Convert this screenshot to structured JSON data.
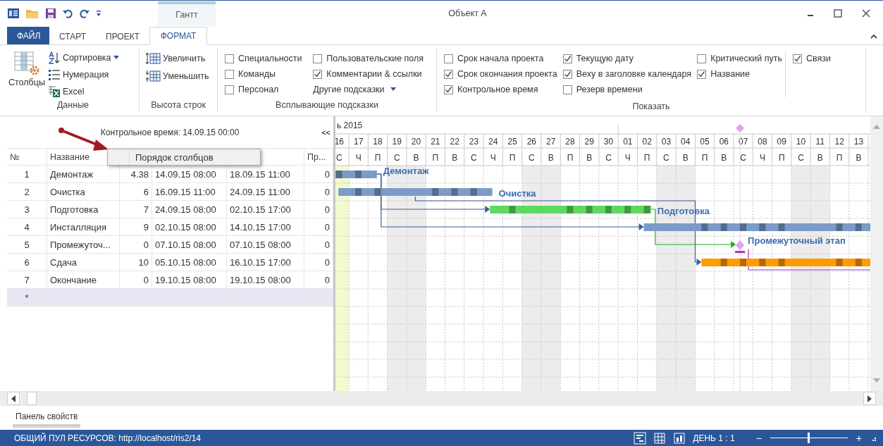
{
  "window": {
    "title": "Объект А",
    "context_tab": "Гантт"
  },
  "ribbon_tabs": [
    {
      "label": "ФАЙЛ",
      "kind": "file",
      "selected": false
    },
    {
      "label": "СТАРТ",
      "kind": "tab",
      "selected": false
    },
    {
      "label": "ПРОЕКТ",
      "kind": "tab",
      "selected": false
    },
    {
      "label": "ФОРМАТ",
      "kind": "tab",
      "selected": true
    }
  ],
  "data_group": {
    "title": "Данные",
    "columns_button": "Столбцы",
    "items": [
      {
        "label": "Сортировка",
        "kind": "sort",
        "dropdown": true
      },
      {
        "label": "Нумерация",
        "kind": "numbering",
        "dropdown": false
      },
      {
        "label": "Excel",
        "kind": "excel",
        "dropdown": false
      }
    ]
  },
  "row_height_group": {
    "title": "Высота строк",
    "items": [
      {
        "label": "Увеличить",
        "kind": "increase"
      },
      {
        "label": "Уменьшить",
        "kind": "decrease"
      }
    ]
  },
  "tooltips_group": {
    "title": "Всплывающие подсказки",
    "options": [
      {
        "label": "Специальности",
        "checked": false
      },
      {
        "label": "Команды",
        "checked": false
      },
      {
        "label": "Персонал",
        "checked": false
      },
      {
        "label": "Пользовательские поля",
        "checked": false
      },
      {
        "label": "Комментарии & ссылки",
        "checked": true
      }
    ],
    "more": "Другие подсказки"
  },
  "show_group": {
    "title": "Показать",
    "options": [
      {
        "label": "Срок начала проекта",
        "checked": false
      },
      {
        "label": "Срок окончания проекта",
        "checked": true
      },
      {
        "label": "Контрольное время",
        "checked": true
      },
      {
        "label": "Текущую дату",
        "checked": true
      },
      {
        "label": "Веху в заголовке календаря",
        "checked": true
      },
      {
        "label": "Резерв времени",
        "checked": false
      },
      {
        "label": "Критический путь",
        "checked": false
      },
      {
        "label": "Название",
        "checked": true
      }
    ],
    "extra": [
      {
        "label": "Связи",
        "checked": true
      }
    ]
  },
  "control_time": "Контрольное время: 14.09.15 00:00",
  "collapse_button": "<<",
  "table": {
    "columns": [
      "№",
      "Название",
      "Пр..."
    ],
    "rows": [
      {
        "num": "1",
        "name": "Демонтаж",
        "duration": "4.38",
        "start": "14.09.15 08:00",
        "finish": "18.09.15 11:00",
        "column_6": "0",
        "bar": {
          "kind": "task",
          "color": "#7b9bc8",
          "label": "Демонтаж"
        }
      },
      {
        "num": "2",
        "name": "Очистка",
        "duration": "6",
        "start": "16.09.15 11:00",
        "finish": "24.09.15 11:00",
        "column_6": "0",
        "bar": {
          "kind": "task",
          "color": "#7b9bc8",
          "label": "Очистка"
        }
      },
      {
        "num": "3",
        "name": "Подготовка",
        "duration": "7",
        "start": "24.09.15 08:00",
        "finish": "02.10.15 17:00",
        "column_6": "0",
        "bar": {
          "kind": "task",
          "color": "#5fd85f",
          "label": "Подготовка"
        }
      },
      {
        "num": "4",
        "name": "Инсталляция",
        "duration": "9",
        "start": "02.10.15 08:00",
        "finish": "14.10.15 17:00",
        "column_6": "0",
        "bar": {
          "kind": "task",
          "color": "#7b9bc8"
        }
      },
      {
        "num": "5",
        "name": "Промежуточ...",
        "duration": "0",
        "start": "07.10.15 08:00",
        "finish": "07.10.15 08:00",
        "column_6": "0",
        "bar": {
          "kind": "milestone",
          "color": "#e6a0f0",
          "label": "Промежуточный этап"
        }
      },
      {
        "num": "6",
        "name": "Сдача",
        "duration": "10",
        "start": "05.10.15 08:00",
        "finish": "16.10.15 17:00",
        "column_6": "0",
        "bar": {
          "kind": "task",
          "color": "#ff9a00"
        }
      },
      {
        "num": "7",
        "name": "Окончание",
        "duration": "0",
        "start": "19.10.15 08:00",
        "finish": "19.10.15 08:00",
        "column_6": "0"
      }
    ],
    "new_row_marker": "*"
  },
  "context_menu": {
    "items": [
      {
        "label": "Порядок столбцов"
      }
    ]
  },
  "gantt": {
    "month": "ь 2015",
    "days": [
      {
        "day": "16",
        "weekday": "С",
        "weekend": false,
        "today": true
      },
      {
        "day": "17",
        "weekday": "Ч",
        "weekend": false,
        "today": false
      },
      {
        "day": "18",
        "weekday": "П",
        "weekend": false,
        "today": false
      },
      {
        "day": "19",
        "weekday": "С",
        "weekend": true,
        "today": false
      },
      {
        "day": "20",
        "weekday": "В",
        "weekend": true,
        "today": false
      },
      {
        "day": "21",
        "weekday": "П",
        "weekend": false,
        "today": false
      },
      {
        "day": "22",
        "weekday": "В",
        "weekend": false,
        "today": false
      },
      {
        "day": "23",
        "weekday": "С",
        "weekend": false,
        "today": false
      },
      {
        "day": "24",
        "weekday": "Ч",
        "weekend": false,
        "today": false
      },
      {
        "day": "25",
        "weekday": "П",
        "weekend": false,
        "today": false
      },
      {
        "day": "26",
        "weekday": "С",
        "weekend": true,
        "today": false
      },
      {
        "day": "27",
        "weekday": "В",
        "weekend": true,
        "today": false
      },
      {
        "day": "28",
        "weekday": "П",
        "weekend": false,
        "today": false
      },
      {
        "day": "29",
        "weekday": "В",
        "weekend": false,
        "today": false
      },
      {
        "day": "30",
        "weekday": "С",
        "weekend": false,
        "today": false
      },
      {
        "day": "01",
        "weekday": "Ч",
        "weekend": false,
        "today": false
      },
      {
        "day": "02",
        "weekday": "П",
        "weekend": false,
        "today": false
      },
      {
        "day": "03",
        "weekday": "С",
        "weekend": true,
        "today": false
      },
      {
        "day": "04",
        "weekday": "В",
        "weekend": true,
        "today": false
      },
      {
        "day": "05",
        "weekday": "П",
        "weekend": false,
        "today": false
      },
      {
        "day": "06",
        "weekday": "В",
        "weekend": false,
        "today": false
      },
      {
        "day": "07",
        "weekday": "С",
        "weekend": false,
        "today": false
      },
      {
        "day": "08",
        "weekday": "Ч",
        "weekend": false,
        "today": false
      },
      {
        "day": "09",
        "weekday": "П",
        "weekend": false,
        "today": false
      },
      {
        "day": "10",
        "weekday": "С",
        "weekend": true,
        "today": false
      },
      {
        "day": "11",
        "weekday": "В",
        "weekend": true,
        "today": false
      },
      {
        "day": "12",
        "weekday": "П",
        "weekend": false,
        "today": false
      },
      {
        "day": "13",
        "weekday": "В",
        "weekend": false,
        "today": false
      }
    ]
  },
  "property_panel": "Панель свойств",
  "status_bar": {
    "text": "ОБЩИЙ ПУЛ РЕСУРСОВ: http://localhost/ris2/14",
    "scale": "ДЕНЬ 1 : 1",
    "zoom_out": "−",
    "zoom_in": "+",
    "zoom": {
      "level": 0.48
    }
  }
}
